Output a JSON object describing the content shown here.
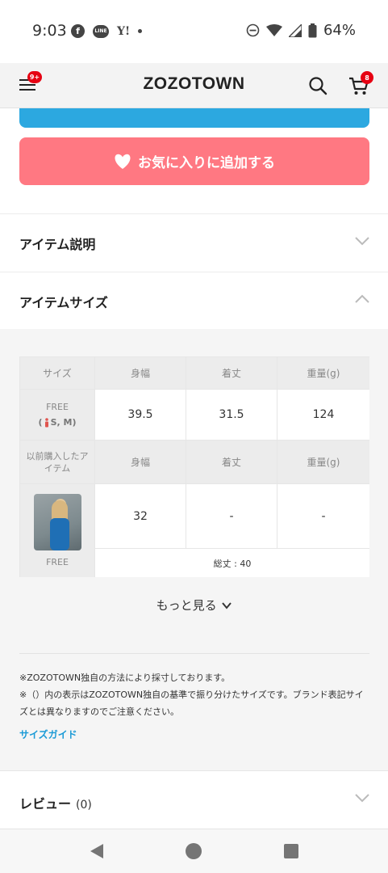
{
  "status_bar": {
    "time": "9:03",
    "battery_percent": "64%",
    "left_icons": [
      "facebook-icon",
      "line-icon",
      "yahoo-icon",
      "dot-icon"
    ],
    "right_icons": [
      "dnd-icon",
      "wifi-icon",
      "signal-icon",
      "battery-icon"
    ],
    "fb_glyph": "f",
    "line_glyph": "LINE",
    "yahoo_glyph": "Y!"
  },
  "header": {
    "logo": "ZOZOTOWN",
    "menu_badge": "9+",
    "cart_badge": "8",
    "badge_color": "#e60012"
  },
  "favorite_button": {
    "label": "お気に入りに追加する",
    "color": "#ff7882"
  },
  "accordion": {
    "item_description": "アイテム説明",
    "item_size": "アイテムサイズ"
  },
  "size_table": {
    "headers": [
      "サイズ",
      "身幅",
      "着丈",
      "重量(g)"
    ],
    "size_name": "FREE",
    "size_sub_prefix": "(",
    "size_sub_suffix": "S, M)",
    "row_values": [
      "39.5",
      "31.5",
      "124"
    ],
    "past_header": "以前購入したアイテム",
    "past_headers": [
      "身幅",
      "着丈",
      "重量(g)"
    ],
    "past_values": [
      "32",
      "-",
      "-"
    ],
    "past_size": "FREE",
    "total_length": "総丈 : 40"
  },
  "more_label": "もっと見る",
  "notes": [
    "※ZOZOTOWN独自の方法により採寸しております。",
    "※（）内の表示はZOZOTOWN独自の基準で振り分けたサイズです。ブランド表記サイズとは異なりますのでご注意ください。"
  ],
  "size_guide_label": "サイズガイド",
  "review": {
    "title": "レビュー",
    "count": "(0)"
  },
  "accent_blue": "#2ca8e0"
}
